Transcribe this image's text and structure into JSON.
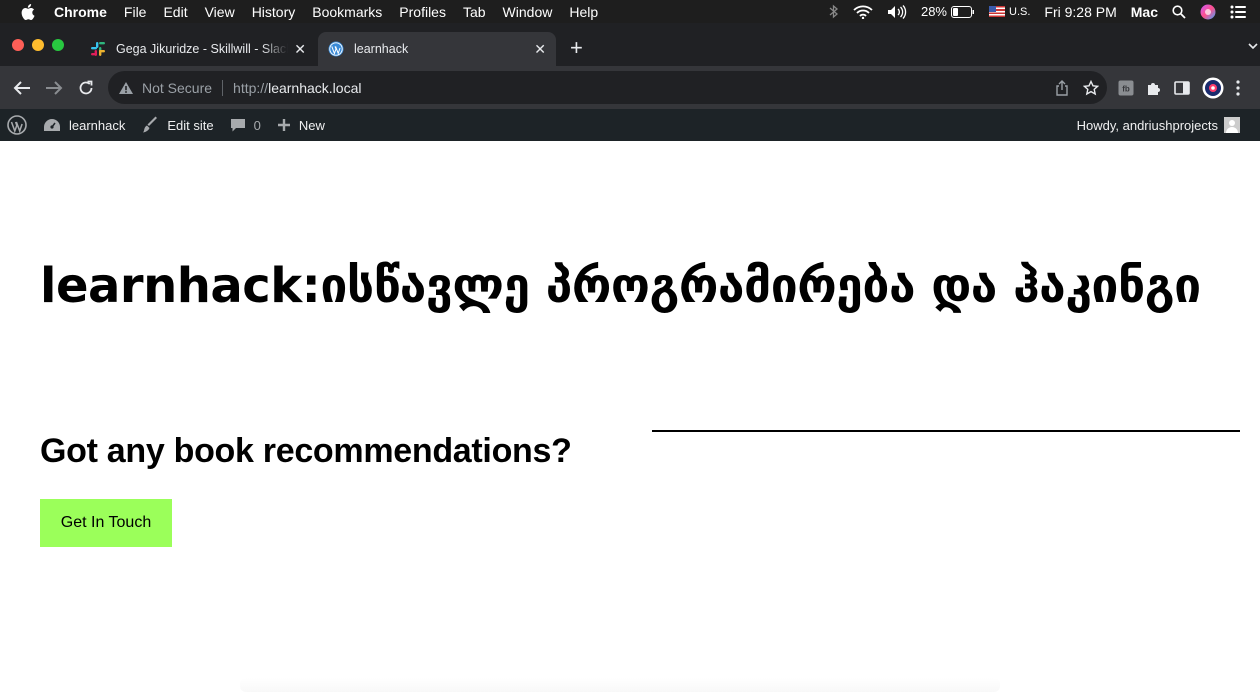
{
  "menubar": {
    "app_name": "Chrome",
    "menus": [
      "File",
      "Edit",
      "View",
      "History",
      "Bookmarks",
      "Profiles",
      "Tab",
      "Window",
      "Help"
    ],
    "battery": "28%",
    "input_source": "U.S.",
    "clock": "Fri 9:28 PM",
    "user": "Mac"
  },
  "tabs": [
    {
      "title": "Gega Jikuridze - Skillwill - Slack",
      "icon": "slack-icon",
      "active": false
    },
    {
      "title": "learnhack",
      "icon": "wordpress-icon",
      "active": true
    }
  ],
  "toolbar": {
    "security_label": "Not Secure",
    "url_scheme": "http://",
    "url_host": "learnhack.local"
  },
  "wpbar": {
    "site_name": "learnhack",
    "edit_site": "Edit site",
    "comments_count": "0",
    "new_label": "New",
    "howdy": "Howdy, andriushprojects"
  },
  "page": {
    "title": "learnhack:ისწავლე პროგრამირება და ჰაკინგი",
    "subheading": "Got any book recommendations?",
    "cta_label": "Get In Touch"
  },
  "colors": {
    "menubar_bg": "#1e1e1e",
    "tabstrip_bg": "#202124",
    "toolbar_bg": "#35363a",
    "wpbar_bg": "#1d2327",
    "cta_bg": "#9bff5a"
  }
}
